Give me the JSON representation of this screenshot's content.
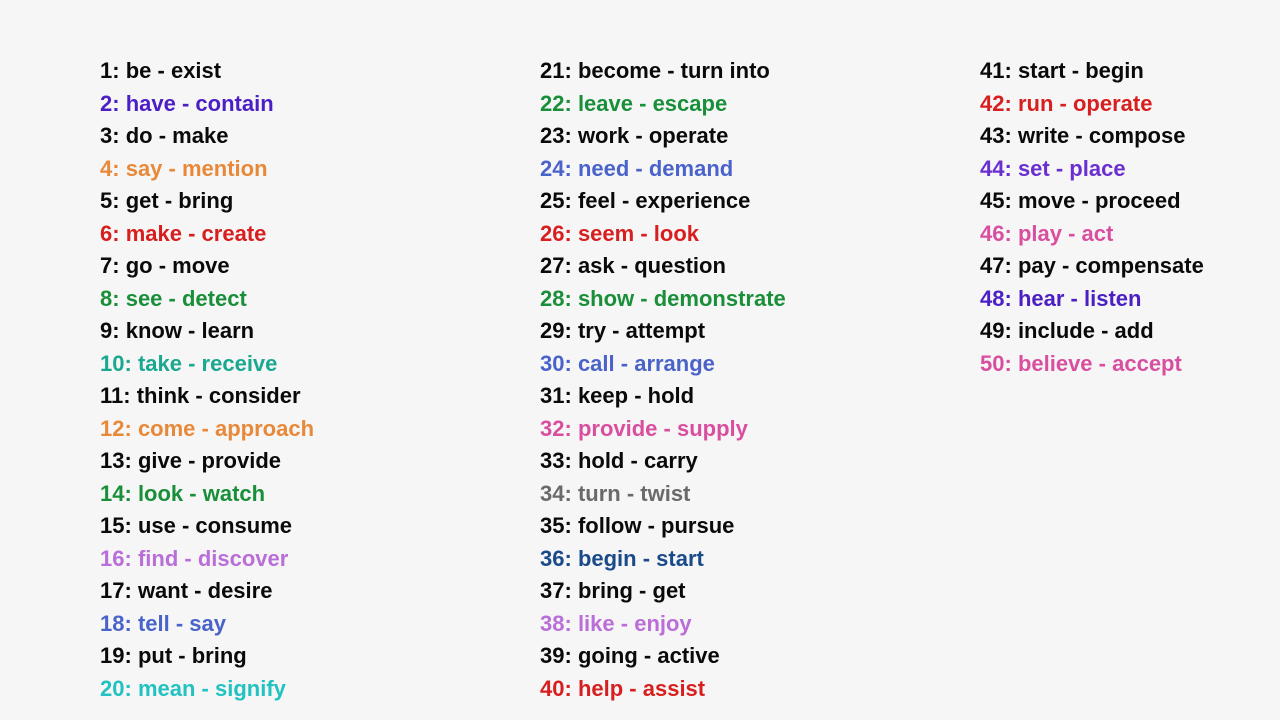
{
  "entries": [
    {
      "n": 1,
      "w": "be",
      "s": "exist",
      "color": "black"
    },
    {
      "n": 2,
      "w": "have",
      "s": "contain",
      "color": "indigo"
    },
    {
      "n": 3,
      "w": "do",
      "s": "make",
      "color": "black"
    },
    {
      "n": 4,
      "w": "say",
      "s": "mention",
      "color": "orange"
    },
    {
      "n": 5,
      "w": "get",
      "s": "bring",
      "color": "black"
    },
    {
      "n": 6,
      "w": "make",
      "s": "create",
      "color": "red"
    },
    {
      "n": 7,
      "w": "go",
      "s": "move",
      "color": "black"
    },
    {
      "n": 8,
      "w": "see",
      "s": "detect",
      "color": "green"
    },
    {
      "n": 9,
      "w": "know",
      "s": "learn",
      "color": "black"
    },
    {
      "n": 10,
      "w": "take",
      "s": "receive",
      "color": "teal"
    },
    {
      "n": 11,
      "w": "think",
      "s": "consider",
      "color": "black"
    },
    {
      "n": 12,
      "w": "come",
      "s": "approach",
      "color": "orange"
    },
    {
      "n": 13,
      "w": "give",
      "s": "provide",
      "color": "black"
    },
    {
      "n": 14,
      "w": "look",
      "s": "watch",
      "color": "green"
    },
    {
      "n": 15,
      "w": "use",
      "s": "consume",
      "color": "black"
    },
    {
      "n": 16,
      "w": "find",
      "s": "discover",
      "color": "violet"
    },
    {
      "n": 17,
      "w": "want",
      "s": "desire",
      "color": "black"
    },
    {
      "n": 18,
      "w": "tell",
      "s": "say",
      "color": "blue"
    },
    {
      "n": 19,
      "w": "put",
      "s": "bring",
      "color": "black"
    },
    {
      "n": 20,
      "w": "mean",
      "s": "signify",
      "color": "cyan"
    },
    {
      "n": 21,
      "w": "become",
      "s": "turn into",
      "color": "black"
    },
    {
      "n": 22,
      "w": "leave",
      "s": "escape",
      "color": "green"
    },
    {
      "n": 23,
      "w": "work",
      "s": "operate",
      "color": "black"
    },
    {
      "n": 24,
      "w": "need",
      "s": "demand",
      "color": "blue"
    },
    {
      "n": 25,
      "w": "feel",
      "s": "experience",
      "color": "black"
    },
    {
      "n": 26,
      "w": "seem",
      "s": "look",
      "color": "red"
    },
    {
      "n": 27,
      "w": "ask",
      "s": "question",
      "color": "black"
    },
    {
      "n": 28,
      "w": "show",
      "s": "demonstrate",
      "color": "green"
    },
    {
      "n": 29,
      "w": "try",
      "s": "attempt",
      "color": "black"
    },
    {
      "n": 30,
      "w": "call",
      "s": "arrange",
      "color": "blue"
    },
    {
      "n": 31,
      "w": "keep",
      "s": "hold",
      "color": "black"
    },
    {
      "n": 32,
      "w": "provide",
      "s": "supply",
      "color": "pink"
    },
    {
      "n": 33,
      "w": "hold",
      "s": "carry",
      "color": "black"
    },
    {
      "n": 34,
      "w": "turn",
      "s": "twist",
      "color": "gray"
    },
    {
      "n": 35,
      "w": "follow",
      "s": "pursue",
      "color": "black"
    },
    {
      "n": 36,
      "w": "begin",
      "s": "start",
      "color": "navy"
    },
    {
      "n": 37,
      "w": "bring",
      "s": "get",
      "color": "black"
    },
    {
      "n": 38,
      "w": "like",
      "s": "enjoy",
      "color": "violet"
    },
    {
      "n": 39,
      "w": "going",
      "s": "active",
      "color": "black"
    },
    {
      "n": 40,
      "w": "help",
      "s": "assist",
      "color": "red"
    },
    {
      "n": 41,
      "w": "start",
      "s": "begin",
      "color": "black"
    },
    {
      "n": 42,
      "w": "run",
      "s": "operate",
      "color": "red"
    },
    {
      "n": 43,
      "w": "write",
      "s": "compose",
      "color": "black"
    },
    {
      "n": 44,
      "w": "set",
      "s": "place",
      "color": "purple"
    },
    {
      "n": 45,
      "w": "move",
      "s": "proceed",
      "color": "black"
    },
    {
      "n": 46,
      "w": "play",
      "s": "act",
      "color": "pink"
    },
    {
      "n": 47,
      "w": "pay",
      "s": "compensate",
      "color": "black"
    },
    {
      "n": 48,
      "w": "hear",
      "s": "listen",
      "color": "indigo"
    },
    {
      "n": 49,
      "w": "include",
      "s": "add",
      "color": "black"
    },
    {
      "n": 50,
      "w": "believe",
      "s": "accept",
      "color": "pink"
    }
  ],
  "columns": [
    {
      "start": 1,
      "end": 20
    },
    {
      "start": 21,
      "end": 40
    },
    {
      "start": 41,
      "end": 50
    }
  ]
}
